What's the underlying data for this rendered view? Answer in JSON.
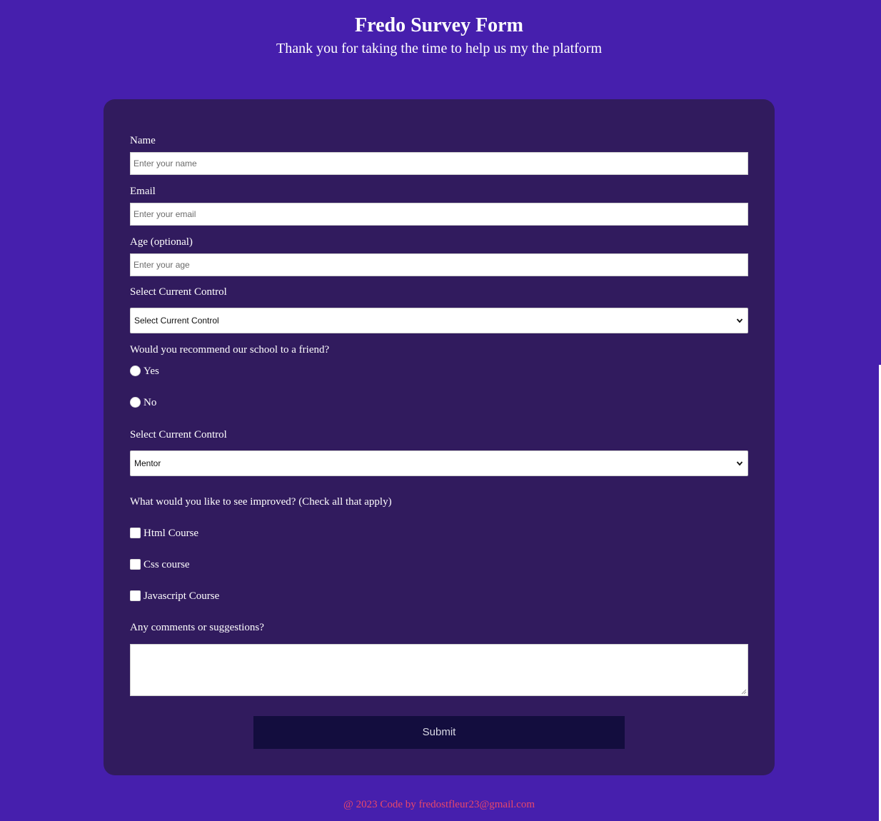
{
  "header": {
    "title": "Fredo Survey Form",
    "subtitle": "Thank you for taking the time to help us my the platform"
  },
  "form": {
    "name": {
      "label": "Name",
      "placeholder": "Enter your name",
      "value": ""
    },
    "email": {
      "label": "Email",
      "placeholder": "Enter your email",
      "value": ""
    },
    "age": {
      "label": "Age (optional)",
      "placeholder": "Enter your age",
      "value": ""
    },
    "control_select": {
      "label": "Select Current Control",
      "selected": "Select Current Control"
    },
    "recommend": {
      "question": "Would you recommend our school to a friend?",
      "options": [
        "Yes",
        "No"
      ],
      "selected": null
    },
    "role_select": {
      "label": "Select Current Control",
      "selected": "Mentor"
    },
    "improvements": {
      "question": "What would you like to see improved? (Check all that apply)",
      "options": [
        "Html Course",
        "Css course",
        "Javascript Course"
      ],
      "checked": [
        false,
        false,
        false
      ]
    },
    "comments": {
      "label": "Any comments or suggestions?",
      "value": ""
    },
    "submit_label": "Submit"
  },
  "footer": {
    "text": "@ 2023 Code by fredostfleur23@gmail.com"
  },
  "colors": {
    "page_background": "#461fad",
    "card_background": "#311b5e",
    "submit_background": "#130d3e",
    "footer_text": "#e8476a"
  },
  "icons": {
    "select_arrow": "chevron-down-icon",
    "textarea_resize": "resize-grip-icon"
  }
}
